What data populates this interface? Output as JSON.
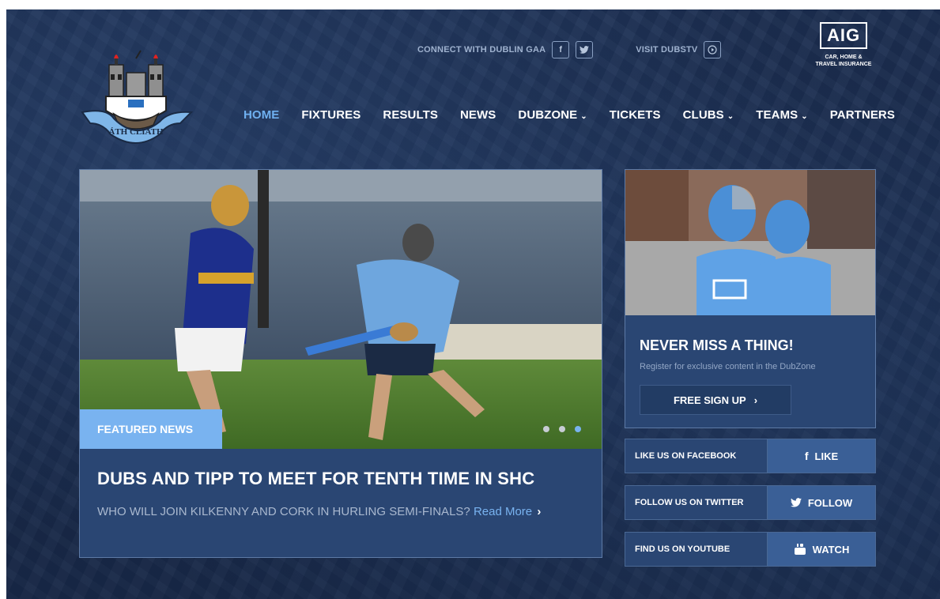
{
  "crest": {
    "motto": "ÁTH CLIATH"
  },
  "topbar": {
    "connect_label": "CONNECT WITH DUBLIN GAA",
    "facebook_glyph": "f",
    "twitter_glyph": "🐦",
    "dubstv_label": "VISIT DUBSTV",
    "play_glyph": "▶"
  },
  "sponsor": {
    "logo": "AIG",
    "tagline_1": "CAR, HOME &",
    "tagline_2": "TRAVEL INSURANCE"
  },
  "nav": {
    "items": [
      {
        "label": "HOME",
        "active": true
      },
      {
        "label": "FIXTURES"
      },
      {
        "label": "RESULTS"
      },
      {
        "label": "NEWS"
      },
      {
        "label": "DUBZONE",
        "dropdown": true
      },
      {
        "label": "TICKETS"
      },
      {
        "label": "CLUBS",
        "dropdown": true
      },
      {
        "label": "TEAMS",
        "dropdown": true
      },
      {
        "label": "PARTNERS"
      }
    ],
    "caret": "⌄"
  },
  "hero": {
    "badge": "FEATURED NEWS",
    "headline": "DUBS AND TIPP TO MEET FOR TENTH TIME IN SHC",
    "subtext": "WHO WILL JOIN KILKENNY AND CORK IN HURLING SEMI-FINALS?",
    "read_more": "Read More",
    "chevron": "›",
    "slides": 3,
    "active_slide": 3
  },
  "signup": {
    "title": "NEVER MISS A THING!",
    "desc": "Register for exclusive content in the DubZone",
    "button": "FREE SIGN UP",
    "chevron": "›"
  },
  "social": [
    {
      "label": "LIKE US ON FACEBOOK",
      "action": "LIKE",
      "icon": "facebook-icon",
      "glyph": "f"
    },
    {
      "label": "FOLLOW US ON TWITTER",
      "action": "FOLLOW",
      "icon": "twitter-icon",
      "glyph": "🐦"
    },
    {
      "label": "FIND US ON YOUTUBE",
      "action": "WATCH",
      "icon": "youtube-icon",
      "glyph": "▶"
    }
  ],
  "colors": {
    "bg": "#1f3358",
    "accent": "#79b3f0",
    "nav_active": "#6fb0f0",
    "panel": "#2a4673"
  }
}
